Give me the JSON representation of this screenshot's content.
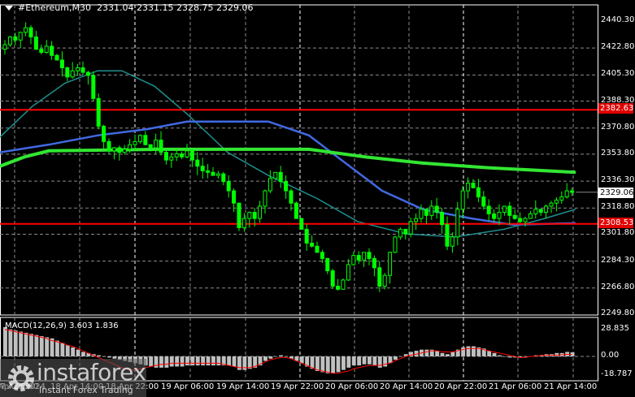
{
  "header": {
    "symbol": "#Ethereum,M30",
    "open": "2331.04",
    "high": "2331.15",
    "low": "2328.75",
    "close": "2329.06"
  },
  "price_axis": [
    "2440.30",
    "2422.80",
    "2405.30",
    "2388.30",
    "2370.80",
    "2353.80",
    "2336.30",
    "2318.80",
    "2301.80",
    "2284.30",
    "2266.80",
    "2249.80"
  ],
  "levels": {
    "upper": "2382.63",
    "lower": "2308.53",
    "current": "2329.06"
  },
  "macd": {
    "label": "MACD(12,26,9) 3.603 1.836",
    "axis": [
      "28.835",
      "0.00",
      "-18.787"
    ]
  },
  "time_axis": [
    "17 Apr 2024",
    "18 Apr 06:00",
    "18 Apr 14:00",
    "18 Apr 22:00",
    "19 Apr 06:00",
    "19 Apr 14:00",
    "19 Apr 22:00",
    "20 Apr 06:00",
    "20 Apr 14:00",
    "20 Apr 22:00",
    "21 Apr 06:00",
    "21 Apr 14:00"
  ],
  "watermark": {
    "name": "instaforex",
    "tagline": "Instant Forex Trading"
  },
  "colors": {
    "bull": "#00ff00",
    "line": "#ff0000",
    "ma200": "#32e632",
    "ma100": "#4169e1",
    "ma50": "#1f8f8f",
    "grid": "#8a8a8a"
  },
  "closes": [
    2425,
    2430,
    2428,
    2433,
    2436,
    2430,
    2422,
    2420,
    2424,
    2418,
    2415,
    2410,
    2404,
    2408,
    2410,
    2407,
    2405,
    2390,
    2372,
    2362,
    2356,
    2358,
    2355,
    2357,
    2360,
    2362,
    2366,
    2360,
    2358,
    2363,
    2355,
    2350,
    2352,
    2354,
    2352,
    2356,
    2350,
    2346,
    2343,
    2342,
    2340,
    2341,
    2336,
    2330,
    2322,
    2306,
    2312,
    2316,
    2312,
    2320,
    2330,
    2338,
    2342,
    2336,
    2330,
    2322,
    2312,
    2305,
    2296,
    2294,
    2290,
    2286,
    2278,
    2268,
    2266,
    2272,
    2282,
    2288,
    2285,
    2290,
    2286,
    2280,
    2268,
    2275,
    2290,
    2300,
    2305,
    2302,
    2310,
    2312,
    2318,
    2314,
    2320,
    2316,
    2308,
    2294,
    2300,
    2318,
    2330,
    2335,
    2332,
    2326,
    2320,
    2315,
    2312,
    2316,
    2320,
    2314,
    2312,
    2310,
    2312,
    2315,
    2318,
    2316,
    2320,
    2322,
    2324,
    2326,
    2330,
    2329
  ],
  "macd_hist": [
    26,
    24,
    23,
    22,
    21,
    20,
    19,
    18,
    17,
    16,
    14,
    12,
    10,
    8,
    6,
    4,
    3,
    2,
    1,
    0,
    -1,
    -2,
    -3,
    -4,
    -5,
    -6,
    -7,
    -8,
    -9,
    -10,
    -10,
    -10,
    -9,
    -9,
    -9,
    -8,
    -8,
    -8,
    -8,
    -8,
    -8,
    -8,
    -8,
    -8,
    -9,
    -12,
    -12,
    -11,
    -10,
    -8,
    -4,
    -2,
    0,
    1,
    0,
    -2,
    -4,
    -6,
    -9,
    -11,
    -13,
    -14,
    -15,
    -15,
    -14,
    -12,
    -10,
    -8,
    -8,
    -7,
    -7,
    -8,
    -10,
    -9,
    -6,
    -3,
    0,
    2,
    4,
    5,
    6,
    6,
    6,
    5,
    3,
    2,
    4,
    6,
    8,
    9,
    9,
    8,
    7,
    5,
    3,
    1,
    0,
    -1,
    -1,
    -1,
    0,
    0,
    1,
    1,
    2,
    2,
    3,
    3,
    4,
    3.6
  ],
  "macd_signal": [
    24,
    23,
    22,
    21,
    20,
    19,
    18,
    17,
    16,
    14,
    13,
    12,
    10,
    9,
    7,
    5,
    3,
    1,
    -1,
    -3,
    -5,
    -7,
    -9,
    -11,
    -12,
    -12,
    -11,
    -10,
    -9,
    -8,
    -7,
    -7,
    -6,
    -6,
    -6,
    -6,
    -6,
    -6,
    -6,
    -6,
    -6,
    -6,
    -7,
    -8,
    -9,
    -10,
    -10,
    -10,
    -9,
    -7,
    -5,
    -3,
    -2,
    -1,
    -1,
    -2,
    -4,
    -6,
    -8,
    -10,
    -12,
    -13,
    -14,
    -15,
    -15,
    -14,
    -13,
    -11,
    -10,
    -9,
    -8,
    -8,
    -8,
    -7,
    -6,
    -4,
    -2,
    0,
    1,
    2,
    3,
    4,
    5,
    5,
    4,
    4,
    4,
    5,
    6,
    7,
    7,
    7,
    6,
    5,
    4,
    3,
    2,
    1,
    0,
    -1,
    -1,
    0,
    0,
    1,
    1,
    1,
    1,
    1.5,
    1.8,
    1.8
  ]
}
